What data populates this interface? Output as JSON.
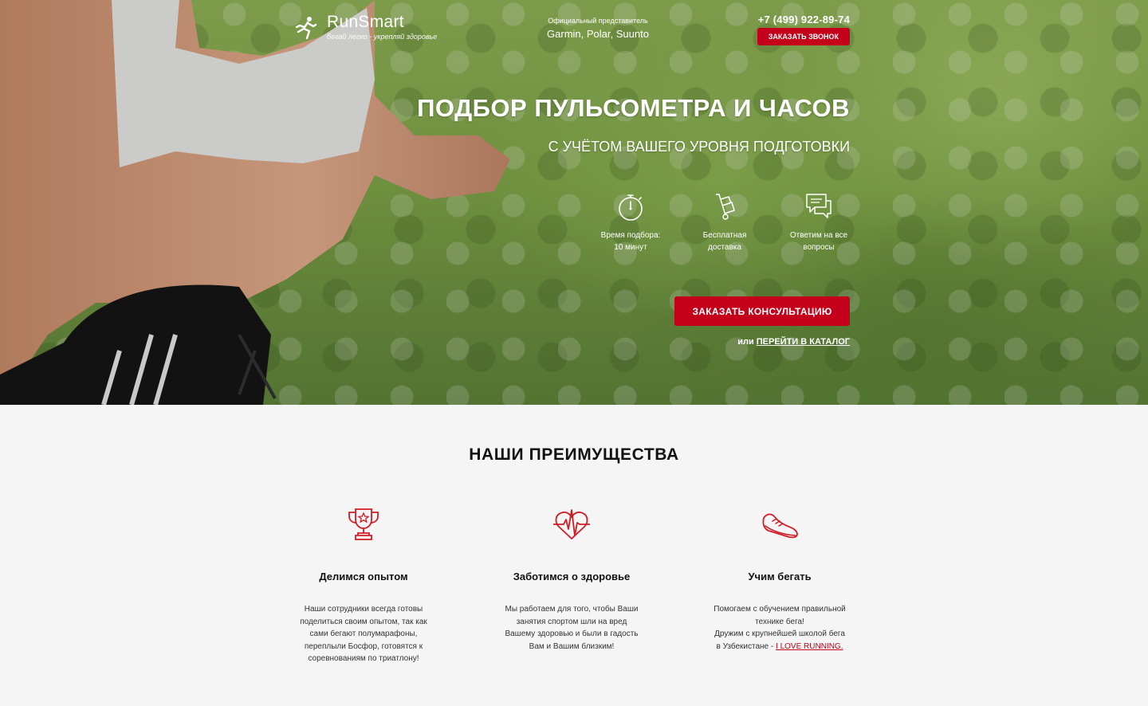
{
  "header": {
    "logo_name": "RunSmart",
    "logo_tagline": "бегай легко - укрепляй здоровье",
    "official_label": "Официальный представитель",
    "official_brands": "Garmin, Polar, Suunto",
    "phone": "+7 (499) 922-89-74",
    "callback_label": "ЗАКАЗАТЬ ЗВОНОК"
  },
  "hero": {
    "title": "ПОДБОР ПУЛЬСОМЕТРА И ЧАСОВ",
    "subtitle": "С УЧЁТОМ ВАШЕГО УРОВНЯ ПОДГОТОВКИ",
    "features": [
      {
        "icon": "stopwatch-icon",
        "line1": "Время подбора:",
        "line2": "10 минут"
      },
      {
        "icon": "hand-truck-icon",
        "line1": "Бесплатная",
        "line2": "доставка"
      },
      {
        "icon": "chat-bubbles-icon",
        "line1": "Ответим на все",
        "line2": "вопросы"
      }
    ],
    "consult_label": "ЗАКАЗАТЬ КОНСУЛЬТАЦИЮ",
    "catalog_prefix": "или",
    "catalog_link": "ПЕРЕЙТИ В КАТАЛОГ"
  },
  "advantages": {
    "title": "НАШИ ПРЕИМУЩЕСТВА",
    "items": [
      {
        "icon": "trophy-icon",
        "title": "Делимся опытом",
        "lines": [
          "Наши сотрудники всегда готовы",
          "поделиться своим опытом, так как",
          "сами бегают полумарафоны,",
          "переплыли Босфор, готовятся к",
          "соревнованиям по триатлону!"
        ]
      },
      {
        "icon": "heart-pulse-icon",
        "title": "Заботимся о здоровье",
        "lines": [
          "Мы работаем для того, чтобы Ваши",
          "занятия спортом шли на вред",
          "Вашему здоровью и были в гадость",
          "Вам и Вашим близким!"
        ]
      },
      {
        "icon": "running-shoe-icon",
        "title": "Учим бегать",
        "lines": [
          "Помогаем с обучением правильной",
          "технике бега!",
          "Дружим с крупнейшей школой бега",
          "в Узбекистане - "
        ],
        "link": "I LOVE RUNNING."
      }
    ]
  },
  "colors": {
    "accent": "#c4001a",
    "section_bg": "#f5f5f5",
    "hero_green": "#7ea548"
  }
}
